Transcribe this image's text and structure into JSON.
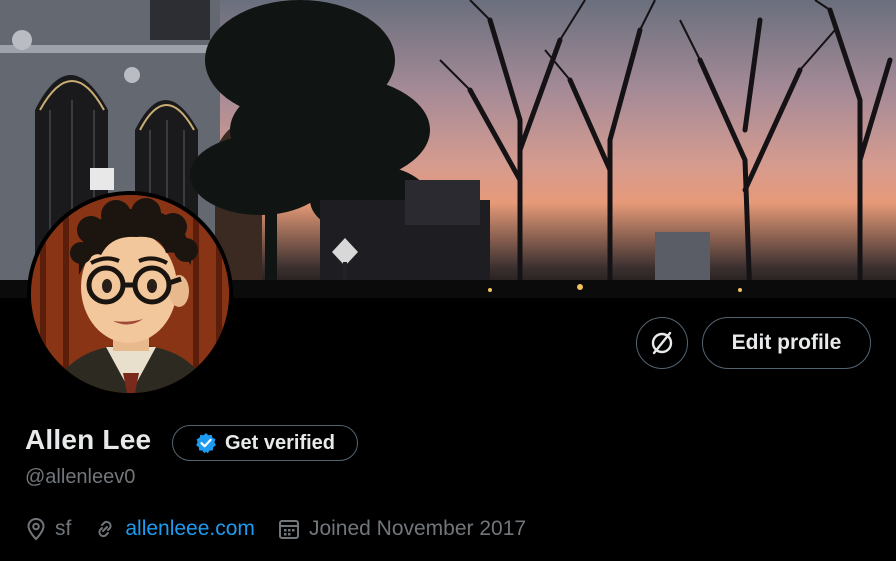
{
  "profile": {
    "name": "Allen Lee",
    "handle": "@allenleev0",
    "location": "sf",
    "website": "allenleee.com",
    "joined": "Joined November 2017"
  },
  "actions": {
    "edit_profile_label": "Edit profile",
    "get_verified_label": "Get verified"
  },
  "icons": {
    "more": "circle-slash-icon",
    "verified": "verified-badge-icon",
    "location": "location-pin-icon",
    "website": "link-icon",
    "joined": "calendar-icon"
  },
  "colors": {
    "background": "#000000",
    "text_primary": "#e7e9ea",
    "text_secondary": "#71767b",
    "accent": "#1d9bf0",
    "border": "#536471"
  }
}
